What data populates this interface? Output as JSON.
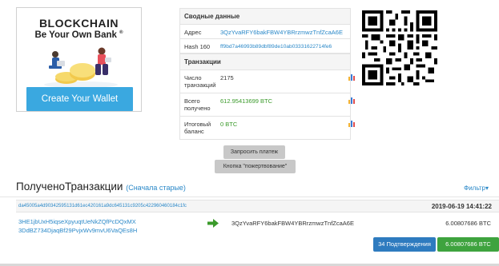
{
  "ad": {
    "brand": "BLOCKCHAIN",
    "tagline": "Be Your Own Bank",
    "tagline_mark": "®",
    "cta": "Create Your Wallet"
  },
  "summary": {
    "title": "Сводные данные",
    "address_label": "Адрес",
    "address_value": "3QzYvaRFY6bakFBW4YBRrzmwzTnfZcaA6E",
    "hash_label": "Hash 160",
    "hash_value": "ff9bd7a46993b89dbf89de10ab03331622714fe6"
  },
  "transactions_table": {
    "title": "Транзакции",
    "rows": [
      {
        "label": "Число транзакций",
        "value": "2175"
      },
      {
        "label": "Всего получено",
        "value": "612.95413699 BTC"
      },
      {
        "label": "Итоговый баланс",
        "value": "0 BTC"
      }
    ]
  },
  "buttons": {
    "request_payment": "Запросить платеж",
    "donation_button": "Кнопка \"пожертвование\""
  },
  "tx_list": {
    "title": "ПолученоТранзакции",
    "order_link": "(Сначала старые)",
    "filter": "Фильтр",
    "filter_caret": "▾",
    "tx": {
      "hash": "da45005a4d90342595131d61ec420161a9dc645131c9205c422960460184c1fc",
      "time": "2019-06-19 14:41:22",
      "from": [
        "3HE1jbUxH5iqseXpyuqtUeNkZQfPcDQxMX",
        "3DdBZ734DjaqBf29PvjxWv9mvU6VaQEs8H"
      ],
      "to": "3QzYvaRFY6bakFBW4YBRrzmwzTnfZcaA6E",
      "amount": "6.00807686 BTC",
      "confirmations": "34 Подтверждения",
      "total": "6.00807686 BTC"
    }
  },
  "colors": {
    "link": "#2a88c8",
    "green_text": "#3a9a2a",
    "cta_blue": "#3aa8e0",
    "confirm_badge": "#2e7bbf",
    "amount_badge": "#3ea33e"
  },
  "icons": {
    "arrow": "green-right-arrow",
    "chart": "bar-chart-icon",
    "qr": "qr-code"
  }
}
